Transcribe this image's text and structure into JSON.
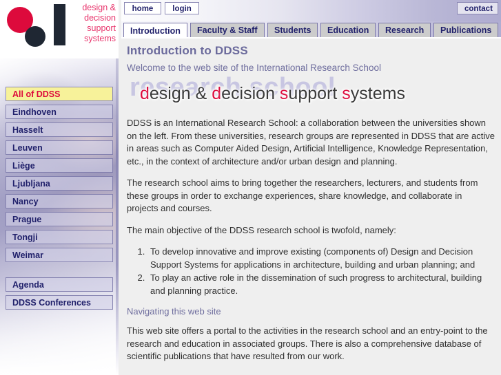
{
  "logo": {
    "alt": "DDSS logo",
    "lines": [
      "design &",
      "decision",
      "support",
      "systems"
    ],
    "colors": {
      "red": "#dd0a3c",
      "dark": "#1f2733",
      "text": "#e8356c"
    }
  },
  "topbar": {
    "home_label": "home",
    "login_label": "login",
    "contact_label": "contact"
  },
  "tabs": [
    {
      "label": "Introduction",
      "active": true
    },
    {
      "label": "Faculty & Staff",
      "active": false
    },
    {
      "label": "Students",
      "active": false
    },
    {
      "label": "Education",
      "active": false
    },
    {
      "label": "Research",
      "active": false
    },
    {
      "label": "Publications",
      "active": false
    }
  ],
  "sidebar": {
    "universities": [
      {
        "label": "All of DDSS",
        "active": true
      },
      {
        "label": "Eindhoven",
        "active": false
      },
      {
        "label": "Hasselt",
        "active": false
      },
      {
        "label": "Leuven",
        "active": false
      },
      {
        "label": "Liège",
        "active": false
      },
      {
        "label": "Ljubljana",
        "active": false
      },
      {
        "label": "Nancy",
        "active": false
      },
      {
        "label": "Prague",
        "active": false
      },
      {
        "label": "Tongji",
        "active": false
      },
      {
        "label": "Weimar",
        "active": false
      }
    ],
    "extras": [
      {
        "label": "Agenda",
        "active": false
      },
      {
        "label": "DDSS Conferences",
        "active": false
      }
    ],
    "active_color": "#f7f29a",
    "active_text_color": "#dd0a3c"
  },
  "main": {
    "title": "Introduction to DDSS",
    "subtitle": "Welcome to the web site of the International Research School",
    "banner": {
      "watermark": "research school",
      "parts": [
        {
          "text": "d",
          "highlight": true
        },
        {
          "text": "esign & ",
          "highlight": false
        },
        {
          "text": "d",
          "highlight": true
        },
        {
          "text": "ecision ",
          "highlight": false
        },
        {
          "text": "s",
          "highlight": true
        },
        {
          "text": "upport ",
          "highlight": false
        },
        {
          "text": "s",
          "highlight": true
        },
        {
          "text": "ystems",
          "highlight": false
        }
      ]
    },
    "paragraphs": [
      "DDSS is an International Research School: a collaboration between the universities shown on the left. From these universities, research groups are represented in DDSS that are active in areas such as Computer Aided Design, Artificial Intelligence, Knowledge Representation, etc., in the context of architecture and/or urban design and planning.",
      "The research school aims to bring together the researchers, lecturers, and students from these groups in order to exchange experiences, share knowledge, and collaborate in projects and courses.",
      "The main objective of the DDSS research school is twofold, namely:"
    ],
    "objectives": [
      "To develop innovative and improve existing (components of) Design and Decision Support Systems for applications in architecture, building and urban planning; and",
      "To play an active role in the dissemination of such progress to architectural, building and planning practice."
    ],
    "navigating_heading": "Navigating this web site",
    "navigating_text": "This web site offers a portal to the activities in the research school and an entry-point to the research and education in associated groups. There is also a comprehensive database of scientific publications that have resulted from our work."
  }
}
